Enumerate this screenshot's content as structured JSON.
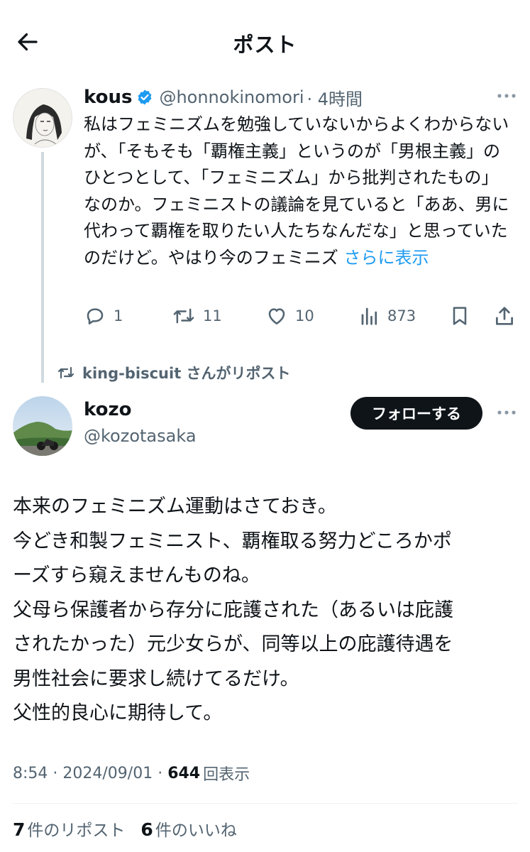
{
  "header": {
    "title": "ポスト"
  },
  "tweet1": {
    "name": "kous",
    "handle": "@honnokinomori",
    "time": "· 4時間",
    "text": "私はフェミニズムを勉強していないからよくわからないが、「そもそも「覇権主義」というのが「男根主義」のひとつとして、「フェミニズム」から批判されたもの」なのか。フェミニストの議論を見ていると「ああ、男に代わって覇権を取りたい人たちなんだな」と思っていたのだけど。やはり今のフェミニズ",
    "show_more": "さらに表示",
    "reply_count": "1",
    "retweet_count": "11",
    "like_count": "10",
    "view_count": "873"
  },
  "repost_note": "king-biscuit さんがリポスト",
  "tweet2": {
    "name": "kozo",
    "handle": "@kozotasaka",
    "follow_label": "フォローする",
    "lines": [
      "本来のフェミニズム運動はさておき。",
      "今どき和製フェミニスト、覇権取る努力どころかポ",
      "ーズすら窺えませんものね。",
      "父母ら保護者から存分に庇護された（あるいは庇護",
      "されたかった）元少女らが、同等以上の庇護待遇を",
      "男性社会に要求し続けてるだけ。",
      "父性的良心に期待して。"
    ],
    "time": "8:54",
    "date": "2024/09/01",
    "views": "644",
    "views_label": "回表示",
    "reposts": "7",
    "reposts_label": "件のリポスト",
    "likes": "6",
    "likes_label": "件のいいね"
  },
  "colors": {
    "accent": "#1d9bf0",
    "muted": "#536471",
    "text": "#0f1419",
    "line": "#cfd9de"
  },
  "icons": [
    "back-arrow-icon",
    "verified-badge-icon",
    "more-icon",
    "reply-icon",
    "retweet-icon",
    "like-icon",
    "views-icon",
    "bookmark-icon",
    "share-icon"
  ]
}
